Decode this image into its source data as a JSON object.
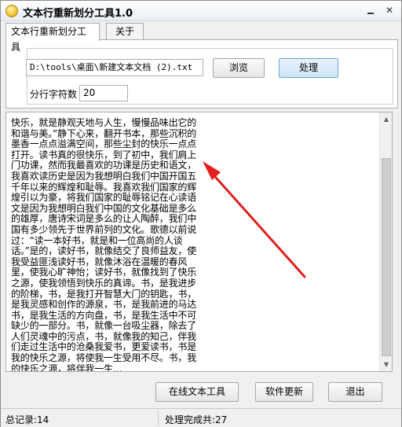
{
  "window": {
    "title": "文本行重新划分工具1.0",
    "minimize_icon": "minimize-icon",
    "close_icon": "close-icon"
  },
  "tabs": [
    {
      "label": "文本行重新划分工具",
      "active": true
    },
    {
      "label": "关于",
      "active": false
    }
  ],
  "form": {
    "path_value": "D:\\tools\\桌面\\新建文本文档 (2).txt",
    "browse_label": "浏览",
    "process_label": "处理",
    "chars_label": "分行字符数",
    "chars_value": "20"
  },
  "content": {
    "text": "快乐，就是静观天地与人生，慢慢品味出它的和谐与美。”静下心来，翻开书本，那些沉积的墨香一点点溢满空间，那些尘封的快乐一点点打开。读书真的很快乐，到了初中，我们肩上门功课，然而我最喜欢的功课是历史和语文，我喜欢读历史是因为我想明白我们中国开国五千年以来的辉煌和耻辱。我喜欢我们国家的辉煌引以为豪，将我们国家的耻辱铭记在心读语文是因为我想明白我们中国的文化基础是多么的雄厚，唐诗宋词是多么的让人陶醉，我们中国有多少领先于世界前列的文化。歌德以前说过：“读一本好书，就是和一位高尚的人谈话。”是的，读好书，就像结交了良师益友，使我受益匪浅读好书，就像沐浴在温暖的春风里，使我心旷神怡；读好书，就像找到了快乐之源，使我领悟到快乐的真谛。书，是我进步的阶梯，书，是我打开智慧大门的钥匙，书，是我灵感和创作的源泉，书，是我前进的马达书，是我生活的方向盘，书，是我生活中不可缺少的一部分。书，就像一台吸尘器，除去了人们灵魂中的污点，书，就像我的知己，伴我们走过生活中的沧桑我爱书，更爱读书，书是我的快乐之源，将使我一生受用不尽。书，我的快乐之源，将伴我一生…"
  },
  "buttons": {
    "online_label": "在线文本工具",
    "update_label": "软件更新",
    "exit_label": "退出"
  },
  "status": {
    "left": "总记录:14",
    "right": "处理完成共:27"
  },
  "colors": {
    "arrow": "#e02020",
    "process_button": "#cfe4f8"
  }
}
